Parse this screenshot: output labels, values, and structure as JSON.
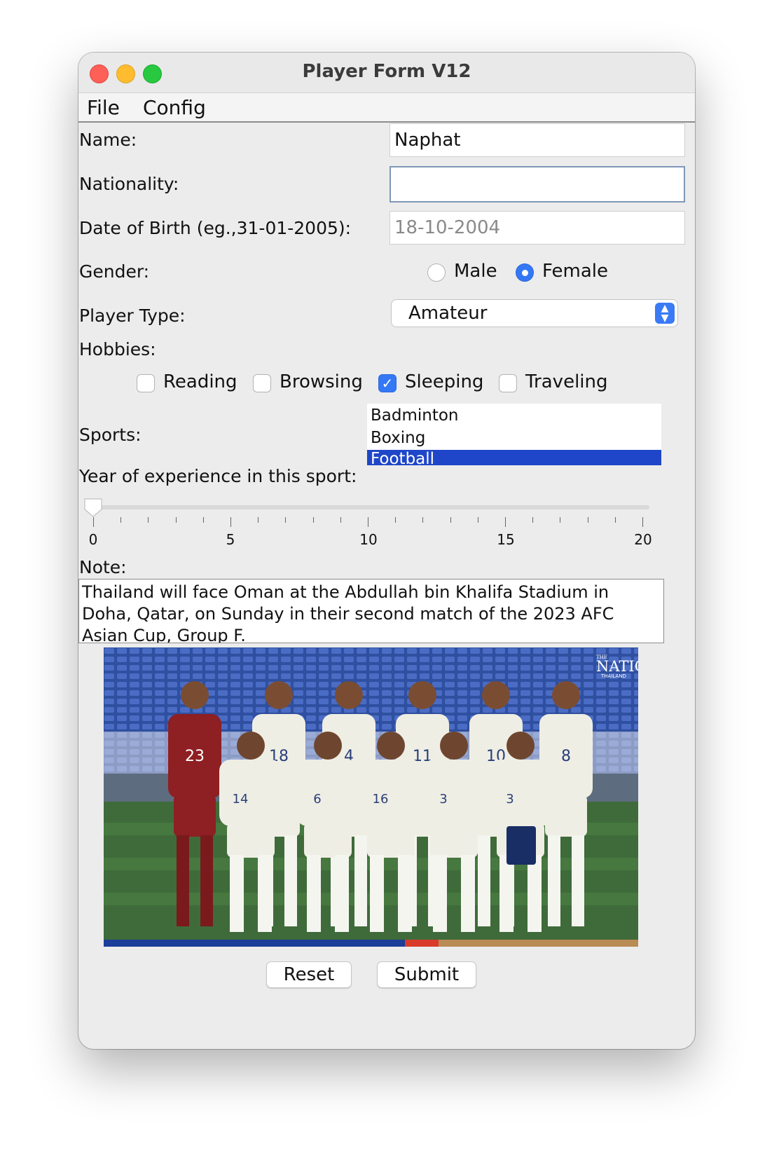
{
  "window": {
    "title": "Player Form V12"
  },
  "menubar": {
    "items": [
      "File",
      "Config"
    ]
  },
  "form": {
    "name": {
      "label": "Name:",
      "value": "Naphat"
    },
    "nationality": {
      "label": "Nationality:",
      "value": ""
    },
    "dob": {
      "label": "Date of Birth (eg.,31-01-2005):",
      "value": "18-10-2004"
    },
    "gender": {
      "label": "Gender:",
      "options": [
        "Male",
        "Female"
      ],
      "selected": "Female"
    },
    "player_type": {
      "label": "Player Type:",
      "value": "Amateur"
    },
    "hobbies": {
      "label": "Hobbies:",
      "options": [
        "Reading",
        "Browsing",
        "Sleeping",
        "Traveling"
      ],
      "checked": [
        "Sleeping"
      ]
    },
    "sports": {
      "label": "Sports:",
      "items": [
        "Badminton",
        "Boxing",
        "Football"
      ],
      "selected": "Football"
    },
    "experience": {
      "label": "Year of experience in this sport:",
      "value": 0,
      "min": 0,
      "max": 20,
      "tick_labels": [
        "0",
        "5",
        "10",
        "15",
        "20"
      ]
    },
    "note": {
      "label": "Note:",
      "value": "Thailand will face Oman at the Abdullah bin Khalifa Stadium in Doha, Qatar, on Sunday in their second match of the 2023 AFC Asian Cup, Group F."
    }
  },
  "photo": {
    "watermark_top": "THE",
    "watermark": "NATION",
    "watermark_sub": "THAILAND",
    "shirt_numbers": [
      "23",
      "18",
      "4",
      "11",
      "10",
      "8",
      "14",
      "6",
      "16",
      "3"
    ]
  },
  "buttons": {
    "reset": "Reset",
    "submit": "Submit"
  },
  "colors": {
    "accent": "#3478f6",
    "list_selection": "#1f46c8",
    "gk_kit": "#8e1f22",
    "outfield_kit": "#efeee4",
    "pitch": "#3f6b3a"
  }
}
